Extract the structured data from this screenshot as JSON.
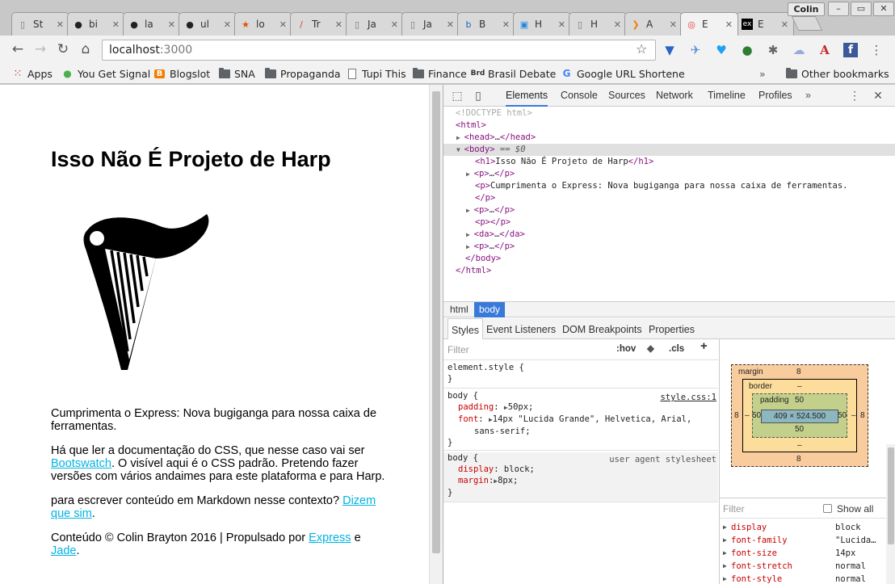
{
  "browser": {
    "tabs": [
      {
        "label": "St",
        "icon": "document-icon"
      },
      {
        "label": "bi",
        "icon": "github-icon"
      },
      {
        "label": "la",
        "icon": "github-icon"
      },
      {
        "label": "ul",
        "icon": "github-icon"
      },
      {
        "label": "lo",
        "icon": "star-icon"
      },
      {
        "label": "Tr",
        "icon": "slash-icon"
      },
      {
        "label": "Ja",
        "icon": "document-icon"
      },
      {
        "label": "Ja",
        "icon": "document-icon"
      },
      {
        "label": "B",
        "icon": "b-icon"
      },
      {
        "label": "H",
        "icon": "image-icon"
      },
      {
        "label": "H",
        "icon": "document-icon"
      },
      {
        "label": "A",
        "icon": "arrow-icon"
      },
      {
        "label": "E",
        "icon": "spiral-icon"
      },
      {
        "label": "E",
        "icon": "ex-icon"
      }
    ],
    "profile_name": "Colin",
    "address": {
      "host": "localhost",
      "port": ":3000"
    },
    "bookmarks": [
      {
        "label": "Apps",
        "icon": "apps-grid-icon"
      },
      {
        "label": "You Get Signal",
        "icon": "globe-icon"
      },
      {
        "label": "Blogslot",
        "icon": "blogger-icon"
      },
      {
        "label": "SNA",
        "icon": "folder-icon"
      },
      {
        "label": "Propaganda",
        "icon": "folder-icon"
      },
      {
        "label": "Tupi This",
        "icon": "document-icon"
      },
      {
        "label": "Finance",
        "icon": "folder-icon"
      },
      {
        "label": "Brasil Debate",
        "icon": "brd-icon"
      },
      {
        "label": "Google URL Shortene",
        "icon": "google-icon"
      }
    ],
    "other_bookmarks": "Other bookmarks"
  },
  "page": {
    "heading": "Isso Não É Projeto de Harp",
    "p1": "Cumprimenta o Express: Nova bugiganga para nossa caixa de ferramentas.",
    "p2_before": "Há que ler a documentação do CSS, que nesse caso vai ser ",
    "p2_link": "Bootswatch",
    "p2_after": ". O visível aqui é o CSS padrão. Pretendo fazer versões com vários andaimes para este plataforma e para Harp.",
    "p3_before": "para escrever conteúdo em Markdown nesse contexto? ",
    "p3_link": "Dizem que sim",
    "p3_after": ".",
    "footer_before": "Conteúdo © Colin Brayton 2016 | Propulsado por ",
    "footer_link1": "Express",
    "footer_mid": " e ",
    "footer_link2": "Jade",
    "footer_after": "."
  },
  "devtools": {
    "tabs": [
      "Elements",
      "Console",
      "Sources",
      "Network",
      "Timeline",
      "Profiles"
    ],
    "dom": {
      "doctype": "<!DOCTYPE html>",
      "html_open": "html",
      "head": "head",
      "head_ellipsis": "…",
      "body": "body",
      "body_suffix": " == $0",
      "h1_text": "Isso Não É Projeto de Harp",
      "p_text": "Cumprimenta o Express: Nova bugiganga para nossa caixa de ferramentas."
    },
    "breadcrumbs": [
      "html",
      "body"
    ],
    "subtabs": [
      "Styles",
      "Event Listeners",
      "DOM Breakpoints",
      "Properties"
    ],
    "styles": {
      "filter_placeholder": "Filter",
      "hov": ":hov",
      "cls": ".cls",
      "element_style": "element.style {",
      "body_rule_selector": "body {",
      "body_rule_source": "style.css:1",
      "padding_prop": "padding",
      "padding_val": "50px;",
      "font_prop": "font",
      "font_val": "14px \"Lucida Grande\", Helvetica, Arial,",
      "font_val2": "sans-serif;",
      "ua_selector": "body {",
      "ua_source": "user agent stylesheet",
      "display_prop": "display",
      "display_val": "block;",
      "margin_prop": "margin",
      "margin_val": "8px;"
    },
    "box_model": {
      "margin_label": "margin",
      "margin": "8",
      "border_label": "border",
      "border": "–",
      "padding_label": "padding",
      "padding": "50",
      "content": "409 × 524.500"
    },
    "computed": {
      "filter_placeholder": "Filter",
      "show_all": "Show all",
      "rows": [
        {
          "k": "display",
          "v": "block"
        },
        {
          "k": "font-family",
          "v": "\"Lucida…"
        },
        {
          "k": "font-size",
          "v": "14px"
        },
        {
          "k": "font-stretch",
          "v": "normal"
        },
        {
          "k": "font-style",
          "v": "normal"
        }
      ]
    }
  }
}
